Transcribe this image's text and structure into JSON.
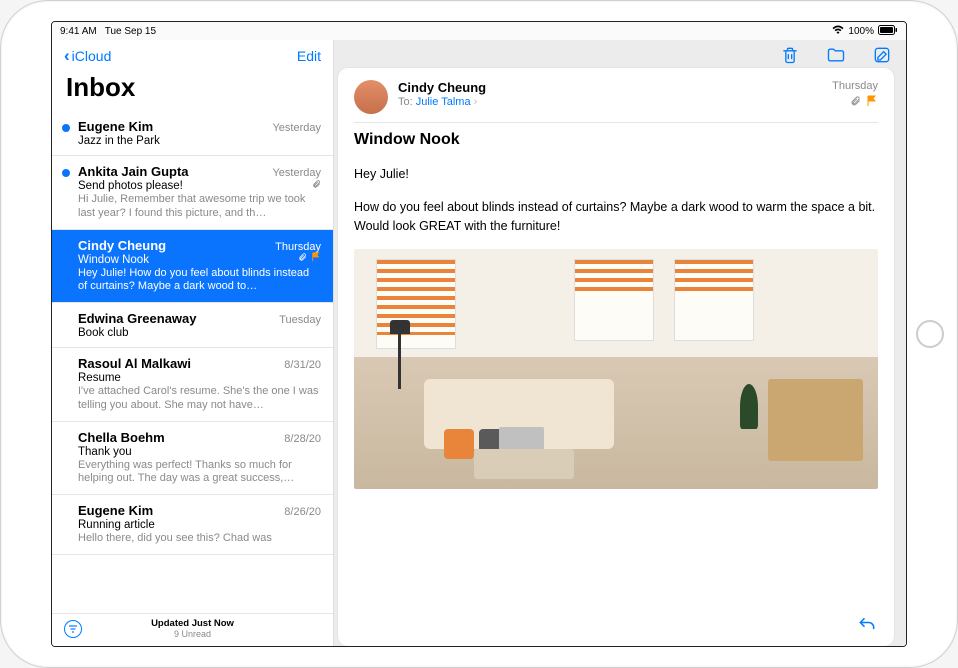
{
  "status": {
    "time": "9:41 AM",
    "date": "Tue Sep 15",
    "battery": "100%"
  },
  "sidebar": {
    "back": "iCloud",
    "edit": "Edit",
    "title": "Inbox",
    "footer": {
      "line1": "Updated Just Now",
      "line2": "9 Unread"
    }
  },
  "messages": [
    {
      "sender": "Eugene Kim",
      "date": "Yesterday",
      "subject": "Jazz in the Park",
      "preview": "",
      "unread": true
    },
    {
      "sender": "Ankita Jain Gupta",
      "date": "Yesterday",
      "subject": "Send photos please!",
      "preview": "Hi Julie, Remember that awesome trip we took last year? I found this picture, and th…",
      "unread": true,
      "attachment": true
    },
    {
      "sender": "Cindy Cheung",
      "date": "Thursday",
      "subject": "Window Nook",
      "preview": "Hey Julie! How do you feel about blinds instead of curtains? Maybe a dark wood to…",
      "selected": true,
      "attachment": true,
      "flagged": true
    },
    {
      "sender": "Edwina Greenaway",
      "date": "Tuesday",
      "subject": "Book club",
      "preview": ""
    },
    {
      "sender": "Rasoul Al Malkawi",
      "date": "8/31/20",
      "subject": "Resume",
      "preview": "I've attached Carol's resume. She's the one I was telling you about. She may not have…"
    },
    {
      "sender": "Chella Boehm",
      "date": "8/28/20",
      "subject": "Thank you",
      "preview": "Everything was perfect! Thanks so much for helping out. The day was a great success,…"
    },
    {
      "sender": "Eugene Kim",
      "date": "8/26/20",
      "subject": "Running article",
      "preview": "Hello there, did you see this? Chad was"
    }
  ],
  "detail": {
    "from": "Cindy Cheung",
    "to_label": "To:",
    "to": "Julie Talma",
    "date": "Thursday",
    "subject": "Window Nook",
    "greeting": "Hey Julie!",
    "body": "How do you feel about blinds instead of curtains? Maybe a dark wood to warm the space a bit. Would look GREAT with the furniture!"
  }
}
